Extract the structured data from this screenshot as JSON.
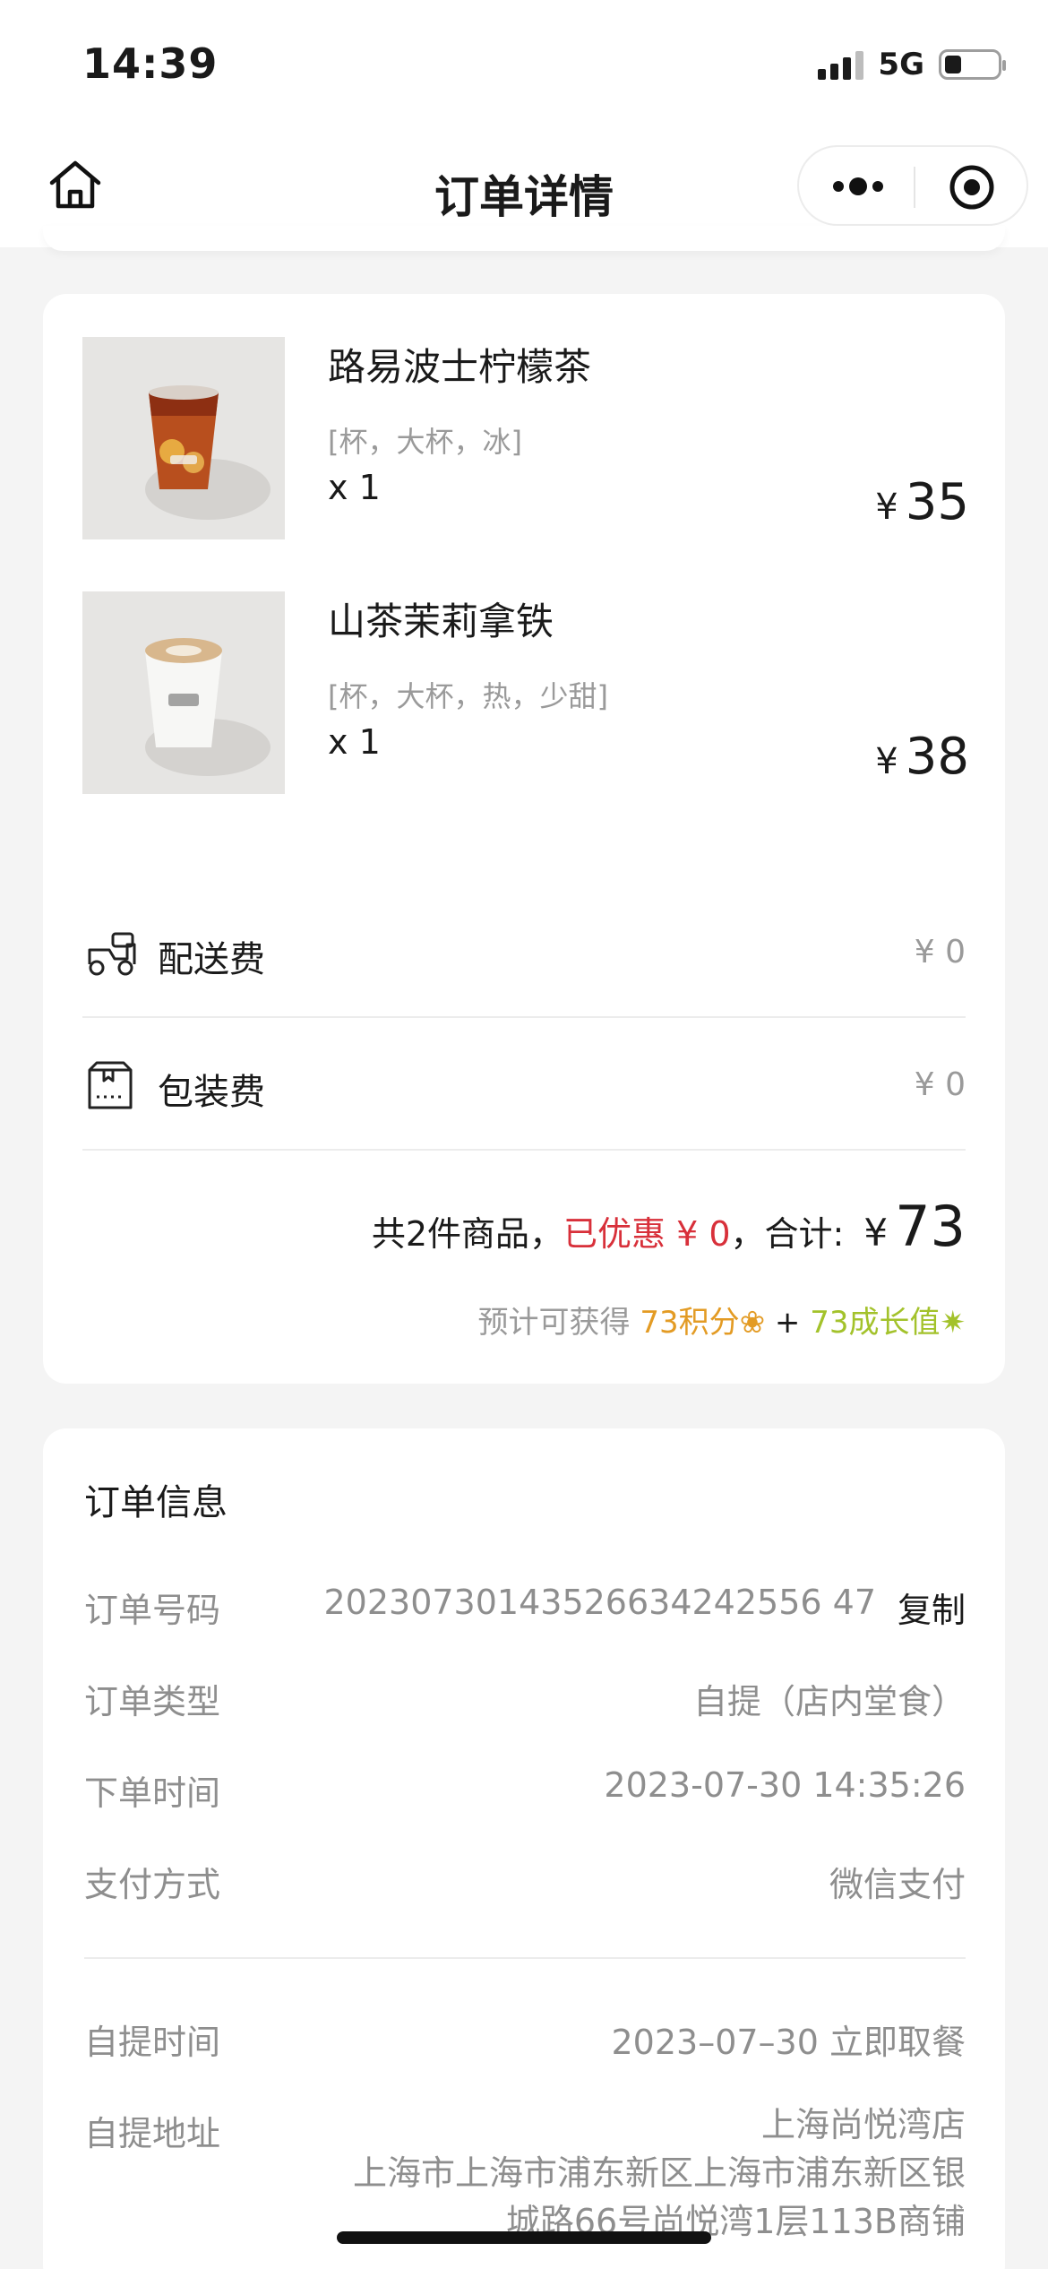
{
  "status_bar": {
    "time": "14:39",
    "network": "5G"
  },
  "nav": {
    "title": "订单详情"
  },
  "products": [
    {
      "name": "路易波士柠檬茶",
      "spec": "[杯，大杯，冰]",
      "qty": "x 1",
      "currency": "¥",
      "price": "35"
    },
    {
      "name": "山茶茉莉拿铁",
      "spec": "[杯，大杯，热，少甜]",
      "qty": "x 1",
      "currency": "¥",
      "price": "38"
    }
  ],
  "fees": {
    "delivery": {
      "label": "配送费",
      "value": "¥ 0"
    },
    "packaging": {
      "label": "包装费",
      "value": "¥ 0"
    }
  },
  "summary": {
    "count_text": "共2件商品，",
    "discount_text": "已优惠 ¥ 0",
    "sep_text": "，合计:",
    "currency": "¥",
    "total": "73",
    "points_prefix": "预计可获得",
    "points_text": "73积分❀",
    "plus": "+",
    "growth_text": "73成长值✷"
  },
  "order_info": {
    "title": "订单信息",
    "rows": [
      {
        "key": "订单号码",
        "value": "20230730143526634242556 47"
      },
      {
        "key": "订单类型",
        "value": "自提（店内堂食）"
      },
      {
        "key": "下单时间",
        "value": "2023-07-30 14:35:26"
      },
      {
        "key": "支付方式",
        "value": "微信支付"
      }
    ],
    "copy_label": "复制",
    "pickup": [
      {
        "key": "自提时间",
        "value": "2023–07–30 立即取餐"
      },
      {
        "key": "自提地址",
        "lines": [
          "上海尚悦湾店",
          "上海市上海市浦东新区上海市浦东新区银",
          "城路66号尚悦湾1层113B商铺"
        ]
      }
    ]
  },
  "colors": {
    "discount": "#d8303a",
    "points": "#e39b24",
    "growth": "#a3c22b",
    "muted": "#8e8e8e"
  }
}
